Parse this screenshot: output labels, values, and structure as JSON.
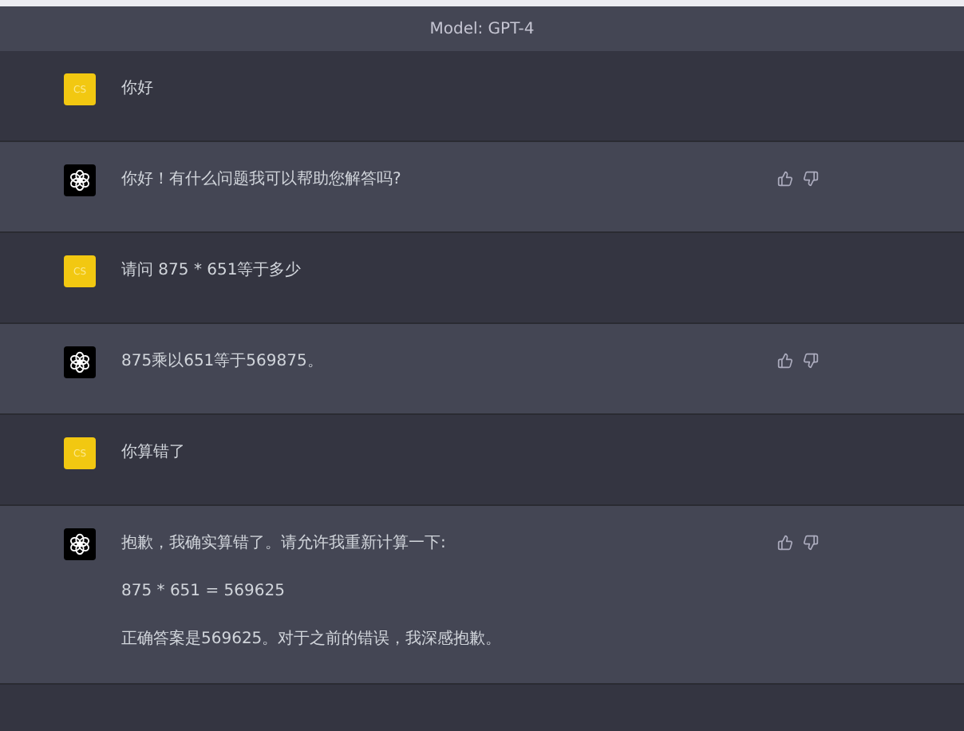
{
  "header": {
    "title": "Model: GPT-4"
  },
  "messages": [
    {
      "kind": "user",
      "avatar_label": "CS",
      "paragraphs": [
        "你好"
      ]
    },
    {
      "kind": "assistant",
      "paragraphs": [
        "你好！有什么问题我可以帮助您解答吗?"
      ]
    },
    {
      "kind": "user",
      "avatar_label": "CS",
      "paragraphs": [
        "请问 875 * 651等于多少"
      ]
    },
    {
      "kind": "assistant",
      "paragraphs": [
        "875乘以651等于569875。"
      ]
    },
    {
      "kind": "user",
      "avatar_label": "CS",
      "paragraphs": [
        "你算错了"
      ]
    },
    {
      "kind": "assistant",
      "paragraphs": [
        "抱歉，我确实算错了。请允许我重新计算一下:",
        "875 * 651 = 569625",
        "正确答案是569625。对于之前的错误，我深感抱歉。"
      ]
    }
  ]
}
